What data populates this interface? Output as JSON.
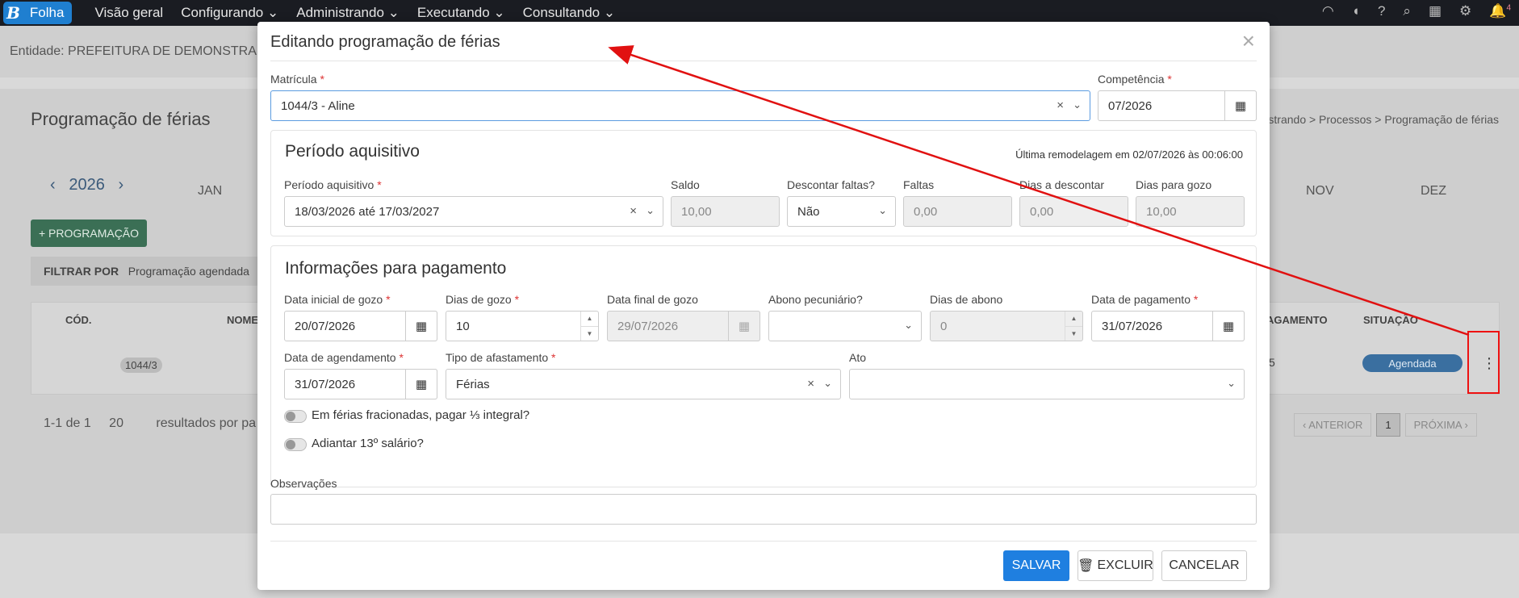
{
  "app": {
    "brand_letter": "B",
    "brand_name": "Folha"
  },
  "nav": {
    "items": [
      "Visão geral",
      "Configurando",
      "Administrando",
      "Executando",
      "Consultando"
    ],
    "notifications_count": "4"
  },
  "entity": {
    "label": "Entidade: PREFEITURA DE DEMONSTRA"
  },
  "background": {
    "page_title": "Programação de férias",
    "year": "2026",
    "months_left": [
      "JAN"
    ],
    "months_right": [
      "NOV",
      "DEZ"
    ],
    "add_button": "+ PROGRAMAÇÃO",
    "filter_label": "FILTRAR POR",
    "filter_value": "Programação agendada",
    "breadcrumb": "strando > Processos > Programação de férias",
    "columns": [
      "CÓD.",
      "NOME",
      "AGAMENTO",
      "SITUAÇÃO"
    ],
    "row_code": "1044/3",
    "row_payment_fragment": "5",
    "row_status": "Agendada",
    "pagination_text": "1-1 de 1",
    "page_size": "20",
    "results_label": "resultados por pa",
    "prev_label": "ANTERIOR",
    "page_number": "1",
    "next_label": "PRÓXIMA"
  },
  "modal": {
    "title": "Editando programação de férias",
    "matricula": {
      "label": "Matrícula",
      "value": "1044/3 - Aline"
    },
    "competencia": {
      "label": "Competência",
      "value": "07/2026"
    },
    "periodo_section": {
      "title": "Período aquisitivo",
      "last_remodel": "Última remodelagem em 02/07/2026 às 00:06:00",
      "periodo": {
        "label": "Período aquisitivo",
        "value": "18/03/2026 até 17/03/2027"
      },
      "saldo": {
        "label": "Saldo",
        "value": "10,00"
      },
      "descontar": {
        "label": "Descontar faltas?",
        "value": "Não"
      },
      "faltas": {
        "label": "Faltas",
        "value": "0,00"
      },
      "dias_descontar": {
        "label": "Dias a descontar",
        "value": "0,00"
      },
      "dias_gozo": {
        "label": "Dias para gozo",
        "value": "10,00"
      }
    },
    "pagamento_section": {
      "title": "Informações para pagamento",
      "data_inicial": {
        "label": "Data inicial de gozo",
        "value": "20/07/2026"
      },
      "dias_de_gozo": {
        "label": "Dias de gozo",
        "value": "10"
      },
      "data_final": {
        "label": "Data final de gozo",
        "value": "29/07/2026"
      },
      "abono": {
        "label": "Abono pecuniário?",
        "value": ""
      },
      "dias_abono": {
        "label": "Dias de abono",
        "value": "0"
      },
      "data_pagamento": {
        "label": "Data de pagamento",
        "value": "31/07/2026"
      },
      "data_agendamento": {
        "label": "Data de agendamento",
        "value": "31/07/2026"
      },
      "tipo_afastamento": {
        "label": "Tipo de afastamento",
        "value": "Férias"
      },
      "ato": {
        "label": "Ato",
        "value": ""
      },
      "toggle_fracionadas": "Em férias fracionadas, pagar ⅓ integral?",
      "toggle_adiantar": "Adiantar 13º salário?"
    },
    "observacoes": {
      "label": "Observações",
      "value": ""
    },
    "buttons": {
      "save": "SALVAR",
      "delete": "EXCLUIR",
      "cancel": "CANCELAR"
    }
  },
  "colors": {
    "primary": "#1f7fe0",
    "annotation": "#e11111",
    "navbar": "#1a1c22"
  }
}
